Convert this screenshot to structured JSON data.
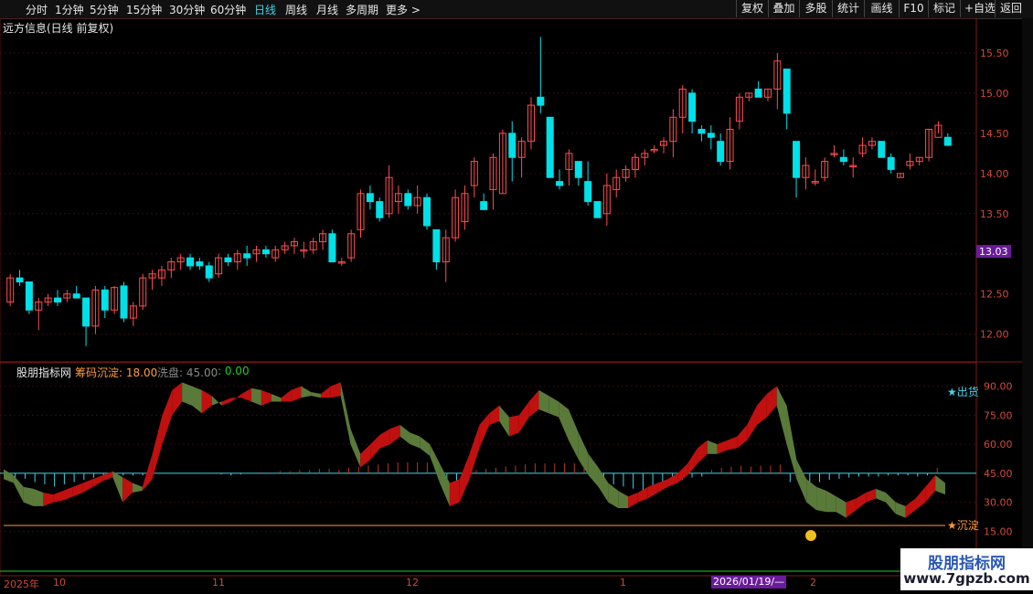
{
  "topbar": {
    "tabs": [
      "分时",
      "1分钟",
      "5分钟",
      "15分钟",
      "30分钟",
      "60分钟",
      "日线",
      "周线",
      "月线",
      "多周期",
      "更多 >"
    ],
    "active_tab": "日线",
    "right_buttons": [
      "复权",
      "叠加",
      "多股",
      "统计",
      "画线",
      "F10",
      "标记",
      "+自选",
      "返回"
    ]
  },
  "main_chart": {
    "title": "远方信息(日线 前复权)",
    "price_axis": [
      "15.50",
      "15.00",
      "14.50",
      "14.00",
      "13.50",
      "13.00",
      "12.50",
      "12.00"
    ],
    "current_price_label": "13.03",
    "colors": {
      "up": "#ff4d4d",
      "down": "#00e0e8",
      "grid": "#3a0a0a",
      "axis_text": "#d04a3a",
      "price_tag_bg": "#6a1b9a"
    }
  },
  "indicator": {
    "name": "股朋指标网",
    "params": [
      {
        "label": "筹码沉淀: 18.00",
        "color": "#ff9a3c"
      },
      {
        "label": "洗盘: 45.00",
        "color": "#888888"
      },
      {
        "label": ": 0.00",
        "color": "#22cc22"
      }
    ],
    "axis": [
      "90.00",
      "75.00",
      "60.00",
      "45.00",
      "30.00",
      "15.00"
    ],
    "annotations": {
      "chuhuo": "★出货",
      "chendian": "★沉淀"
    }
  },
  "time_axis": {
    "labels": [
      "2025年",
      "10",
      "11",
      "12",
      "1",
      "2"
    ],
    "date_marker": "2026/01/19/—"
  },
  "watermark": {
    "line1": "股朋指标网",
    "line2": "www.7gpzb.com"
  },
  "chart_data": {
    "type": "candlestick",
    "ylim": [
      11.7,
      15.75
    ],
    "candles": [
      [
        12.4,
        12.75,
        12.35,
        12.7
      ],
      [
        12.7,
        12.8,
        12.6,
        12.65
      ],
      [
        12.65,
        12.65,
        12.25,
        12.3
      ],
      [
        12.3,
        12.45,
        12.05,
        12.4
      ],
      [
        12.4,
        12.5,
        12.35,
        12.45
      ],
      [
        12.45,
        12.55,
        12.35,
        12.4
      ],
      [
        12.45,
        12.55,
        12.4,
        12.5
      ],
      [
        12.5,
        12.6,
        12.45,
        12.45
      ],
      [
        12.45,
        12.45,
        11.85,
        12.1
      ],
      [
        12.1,
        12.6,
        12.0,
        12.55
      ],
      [
        12.55,
        12.6,
        12.2,
        12.3
      ],
      [
        12.3,
        12.6,
        12.25,
        12.58
      ],
      [
        12.6,
        12.65,
        12.15,
        12.2
      ],
      [
        12.2,
        12.4,
        12.1,
        12.35
      ],
      [
        12.35,
        12.75,
        12.3,
        12.7
      ],
      [
        12.7,
        12.8,
        12.55,
        12.75
      ],
      [
        12.7,
        12.85,
        12.6,
        12.8
      ],
      [
        12.8,
        12.95,
        12.7,
        12.9
      ],
      [
        12.9,
        13.0,
        12.8,
        12.95
      ],
      [
        12.95,
        13.0,
        12.8,
        12.85
      ],
      [
        12.9,
        12.95,
        12.8,
        12.85
      ],
      [
        12.85,
        12.9,
        12.65,
        12.7
      ],
      [
        12.75,
        13.0,
        12.7,
        12.95
      ],
      [
        12.95,
        13.0,
        12.85,
        12.9
      ],
      [
        12.9,
        13.05,
        12.8,
        13.0
      ],
      [
        13.0,
        13.1,
        12.85,
        12.95
      ],
      [
        13.0,
        13.1,
        12.9,
        13.05
      ],
      [
        13.05,
        13.1,
        12.95,
        13.0
      ],
      [
        12.95,
        13.1,
        12.9,
        13.05
      ],
      [
        13.05,
        13.15,
        13.0,
        13.1
      ],
      [
        13.1,
        13.2,
        13.0,
        13.15
      ],
      [
        13.05,
        13.15,
        12.95,
        13.05
      ],
      [
        13.05,
        13.2,
        13.0,
        13.15
      ],
      [
        13.15,
        13.3,
        13.05,
        13.25
      ],
      [
        13.25,
        13.3,
        12.9,
        12.9
      ],
      [
        12.9,
        12.95,
        12.85,
        12.9
      ],
      [
        12.95,
        13.3,
        12.9,
        13.25
      ],
      [
        13.3,
        13.8,
        13.2,
        13.75
      ],
      [
        13.75,
        13.85,
        13.55,
        13.65
      ],
      [
        13.65,
        13.7,
        13.4,
        13.45
      ],
      [
        13.5,
        14.1,
        13.45,
        13.95
      ],
      [
        13.65,
        13.85,
        13.5,
        13.75
      ],
      [
        13.75,
        13.8,
        13.55,
        13.6
      ],
      [
        13.6,
        13.85,
        13.5,
        13.7
      ],
      [
        13.7,
        13.75,
        13.3,
        13.35
      ],
      [
        13.3,
        13.3,
        12.8,
        12.9
      ],
      [
        12.9,
        13.3,
        12.65,
        13.2
      ],
      [
        13.2,
        13.8,
        13.15,
        13.7
      ],
      [
        13.4,
        13.85,
        13.3,
        13.75
      ],
      [
        13.85,
        14.2,
        13.7,
        14.15
      ],
      [
        13.65,
        13.75,
        13.55,
        13.55
      ],
      [
        13.8,
        14.25,
        13.55,
        14.2
      ],
      [
        13.75,
        14.55,
        13.75,
        14.5
      ],
      [
        14.5,
        14.65,
        13.9,
        14.2
      ],
      [
        14.2,
        14.45,
        13.95,
        14.4
      ],
      [
        14.4,
        14.95,
        14.3,
        14.85
      ],
      [
        14.95,
        15.7,
        14.75,
        14.85
      ],
      [
        14.7,
        14.7,
        13.95,
        13.95
      ],
      [
        13.9,
        14.05,
        13.8,
        13.85
      ],
      [
        14.05,
        14.3,
        13.85,
        14.25
      ],
      [
        14.15,
        14.15,
        13.85,
        13.95
      ],
      [
        13.9,
        14.15,
        13.6,
        13.65
      ],
      [
        13.65,
        13.65,
        13.45,
        13.45
      ],
      [
        13.5,
        14.0,
        13.35,
        13.85
      ],
      [
        13.8,
        14.05,
        13.7,
        13.95
      ],
      [
        13.95,
        14.1,
        13.9,
        14.05
      ],
      [
        14.05,
        14.25,
        13.95,
        14.2
      ],
      [
        14.2,
        14.3,
        14.1,
        14.25
      ],
      [
        14.3,
        14.35,
        14.25,
        14.3
      ],
      [
        14.35,
        14.45,
        14.25,
        14.4
      ],
      [
        14.4,
        14.8,
        14.2,
        14.7
      ],
      [
        14.7,
        15.1,
        14.5,
        15.05
      ],
      [
        15.0,
        15.05,
        14.5,
        14.65
      ],
      [
        14.55,
        14.6,
        14.4,
        14.5
      ],
      [
        14.5,
        14.6,
        14.3,
        14.45
      ],
      [
        14.4,
        14.5,
        14.1,
        14.15
      ],
      [
        14.15,
        14.7,
        14.05,
        14.55
      ],
      [
        14.65,
        15.0,
        14.55,
        14.95
      ],
      [
        14.95,
        15.0,
        14.9,
        15.0
      ],
      [
        15.05,
        15.15,
        14.95,
        14.95
      ],
      [
        14.95,
        15.05,
        14.9,
        15.05
      ],
      [
        15.05,
        15.5,
        14.8,
        15.4
      ],
      [
        15.3,
        15.3,
        14.55,
        14.75
      ],
      [
        14.4,
        14.4,
        13.7,
        13.95
      ],
      [
        13.95,
        14.2,
        13.8,
        14.1
      ],
      [
        13.9,
        14.05,
        13.85,
        13.9
      ],
      [
        13.95,
        14.2,
        13.9,
        14.15
      ],
      [
        14.25,
        14.35,
        14.2,
        14.25
      ],
      [
        14.2,
        14.3,
        14.1,
        14.15
      ],
      [
        14.1,
        14.2,
        13.95,
        14.1
      ],
      [
        14.25,
        14.45,
        14.2,
        14.35
      ],
      [
        14.35,
        14.45,
        14.3,
        14.4
      ],
      [
        14.4,
        14.4,
        14.2,
        14.2
      ],
      [
        14.2,
        14.25,
        14.0,
        14.05
      ],
      [
        13.95,
        14.0,
        13.95,
        14.0
      ],
      [
        14.1,
        14.25,
        14.05,
        14.15
      ],
      [
        14.15,
        14.2,
        14.1,
        14.2
      ],
      [
        14.2,
        14.55,
        14.15,
        14.55
      ],
      [
        14.45,
        14.65,
        14.5,
        14.6
      ],
      [
        14.45,
        14.5,
        14.35,
        14.35
      ]
    ],
    "indicator_band": {
      "upper": [
        47,
        44,
        38,
        37,
        35,
        34,
        36,
        38,
        40,
        42,
        44,
        46,
        43,
        40,
        38,
        55,
        75,
        88,
        92,
        90,
        88,
        85,
        80,
        82,
        86,
        89,
        88,
        86,
        84,
        88,
        90,
        87,
        86,
        90,
        92,
        68,
        55,
        60,
        65,
        68,
        70,
        66,
        64,
        60,
        50,
        40,
        42,
        55,
        70,
        76,
        80,
        74,
        75,
        82,
        88,
        85,
        82,
        78,
        66,
        55,
        48,
        40,
        36,
        33,
        35,
        38,
        40,
        42,
        45,
        50,
        58,
        62,
        60,
        62,
        64,
        70,
        80,
        86,
        90,
        80,
        52,
        42,
        38,
        36,
        33,
        30,
        32,
        35,
        37,
        35,
        30,
        28,
        32,
        38,
        44,
        40
      ],
      "lower": [
        42,
        40,
        30,
        28,
        28,
        30,
        31,
        33,
        35,
        38,
        41,
        43,
        30,
        35,
        36,
        42,
        60,
        75,
        82,
        80,
        76,
        80,
        82,
        84,
        84,
        82,
        80,
        82,
        82,
        82,
        84,
        85,
        84,
        84,
        85,
        60,
        48,
        52,
        58,
        60,
        64,
        60,
        58,
        54,
        40,
        28,
        30,
        42,
        58,
        70,
        72,
        64,
        66,
        74,
        78,
        76,
        74,
        62,
        52,
        44,
        38,
        30,
        27,
        27,
        30,
        32,
        35,
        38,
        40,
        44,
        50,
        55,
        55,
        57,
        58,
        62,
        70,
        74,
        80,
        60,
        42,
        30,
        26,
        25,
        25,
        22,
        26,
        30,
        32,
        30,
        24,
        22,
        26,
        30,
        36,
        34
      ]
    },
    "histogram": [
      -2,
      -4,
      -5,
      -8,
      -10,
      -12,
      -10,
      -8,
      -6,
      -4,
      -3,
      -2,
      -2,
      -2,
      -2,
      0,
      0,
      0,
      0,
      0,
      0,
      0,
      -1,
      -2,
      -1,
      0,
      1,
      1,
      2,
      2,
      3,
      3,
      4,
      4,
      3,
      5,
      6,
      7,
      8,
      9,
      10,
      10,
      10,
      10,
      8,
      -12,
      -10,
      -7,
      3,
      4,
      5,
      6,
      7,
      8,
      9,
      9,
      9,
      9,
      9,
      6,
      -4,
      -8,
      -10,
      -12,
      -14,
      -16,
      -14,
      -12,
      -8,
      -6,
      -4,
      -3,
      3,
      5,
      6,
      7,
      6,
      7,
      7,
      8,
      -8,
      -10,
      -10,
      -8,
      -6,
      -5,
      -4,
      -3,
      -3,
      -3,
      -2,
      -2,
      -2,
      -3,
      -2,
      5
    ]
  }
}
